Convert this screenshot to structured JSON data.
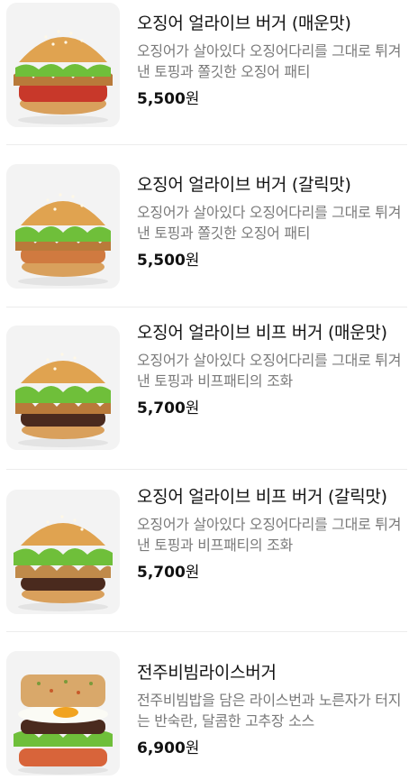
{
  "items": [
    {
      "title": "오징어 얼라이브 버거 (매운맛)",
      "desc": "오징어가 살아있다 오징어다리를 그대로 튀겨 낸 토핑과 쫄깃한 오징어 패티",
      "price": "5,500",
      "currency": "원",
      "image_icon": "squid-burger-spicy-image"
    },
    {
      "title": "오징어 얼라이브 버거 (갈릭맛)",
      "desc": "오징어가 살아있다 오징어다리를 그대로 튀겨 낸 토핑과 쫄깃한 오징어 패티",
      "price": "5,500",
      "currency": "원",
      "image_icon": "squid-burger-garlic-image"
    },
    {
      "title": "오징어 얼라이브 비프 버거 (매운맛)",
      "desc": "오징어가 살아있다 오징어다리를 그대로 튀겨 낸 토핑과 비프패티의 조화",
      "price": "5,700",
      "currency": "원",
      "image_icon": "squid-beef-burger-spicy-image"
    },
    {
      "title": "오징어 얼라이브 비프 버거 (갈릭맛)",
      "desc": "오징어가 살아있다 오징어다리를 그대로 튀겨 낸 토핑과 비프패티의 조화",
      "price": "5,700",
      "currency": "원",
      "image_icon": "squid-beef-burger-garlic-image"
    },
    {
      "title": "전주비빔라이스버거",
      "desc": "전주비빔밥을 담은 라이스번과 노른자가 터지는 반숙란, 달콤한 고추장 소스",
      "price": "6,900",
      "currency": "원",
      "image_icon": "bibim-rice-burger-image"
    }
  ]
}
